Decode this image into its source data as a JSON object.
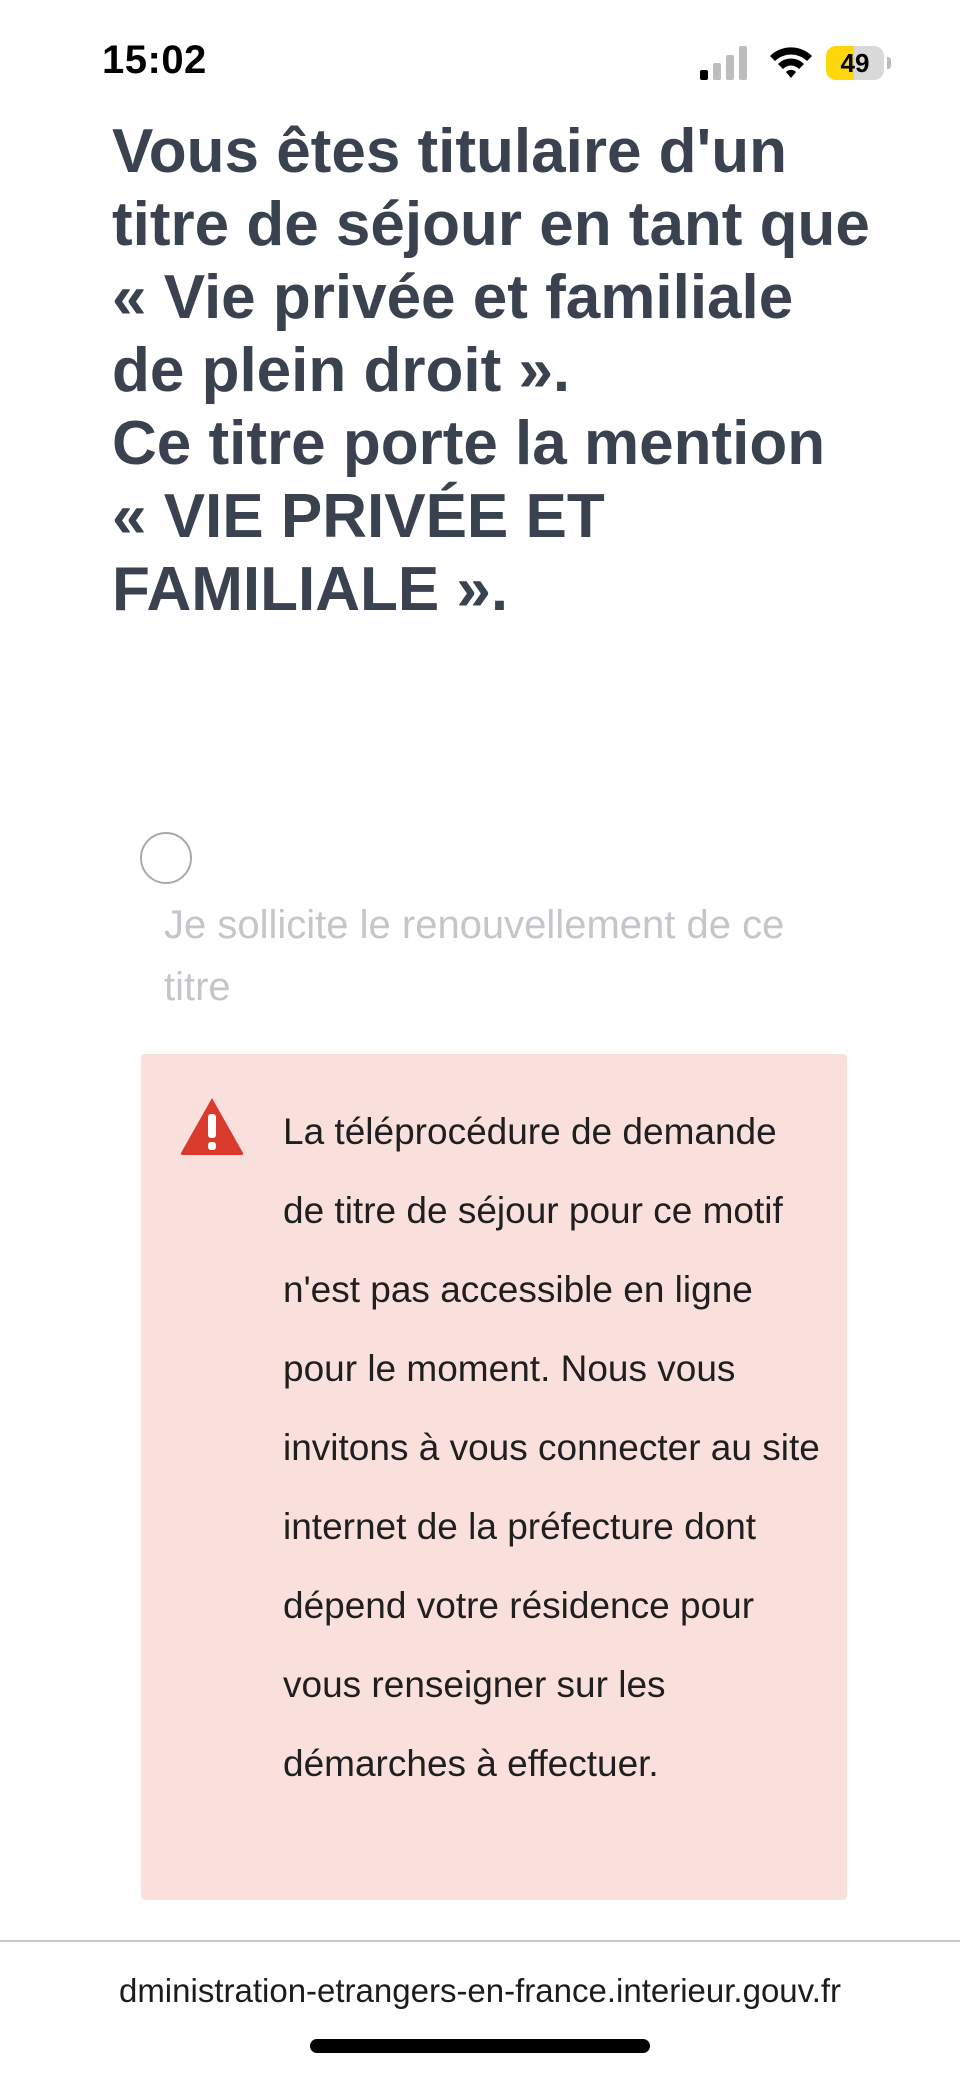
{
  "status_bar": {
    "time": "15:02",
    "battery_level": "49",
    "battery_fraction": 0.49,
    "signal_bars_active": 1,
    "signal_bars_total": 4,
    "icons": [
      "signal-icon",
      "wifi-icon",
      "battery-icon"
    ]
  },
  "heading": {
    "line1": "Vous êtes titulaire d'un titre de séjour en tant que « Vie privée et familiale de plein droit ».",
    "line2": "Ce titre porte la mention « VIE PRIVÉE ET FAMILIALE »."
  },
  "option": {
    "label": "Je sollicite le renouvellement de ce titre",
    "checked": false
  },
  "alert": {
    "icon": "warning-icon",
    "message": "La téléprocédure de demande de titre de séjour pour ce motif n'est pas accessible en ligne pour le moment. Nous vous invitons à vous connecter au site internet de la préfecture dont dépend votre résidence pour vous renseigner sur les démarches à effectuer."
  },
  "browser": {
    "url": "dministration-etrangers-en-france.interieur.gouv.fr"
  },
  "colors": {
    "heading": "#3a4250",
    "alert_background": "#f9e0dc",
    "alert_icon": "#d93a2b",
    "battery_fill": "#ffd60a",
    "radio_label": "#c4c6ca"
  }
}
